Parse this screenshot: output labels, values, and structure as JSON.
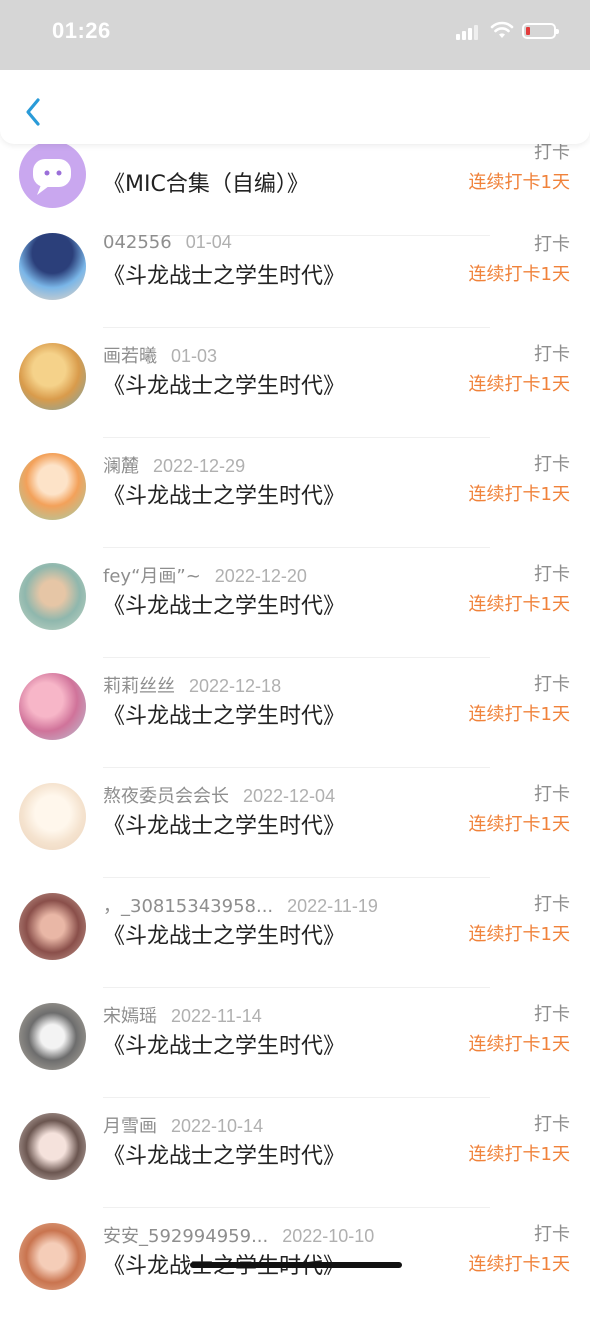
{
  "status_bar": {
    "time": "01:26"
  },
  "nav": {
    "back_icon": "chevron-left-icon"
  },
  "colors": {
    "accent": "#2a9bd8",
    "streak": "#f0823a",
    "muted": "#8e8e8e",
    "text": "#222222"
  },
  "rows": [
    {
      "user": "",
      "date": "",
      "book": "《MIC合集（自编）》",
      "action": "打卡",
      "streak": "连续打卡1天"
    },
    {
      "user": "042556",
      "date": "01-04",
      "book": "《斗龙战士之学生时代》",
      "action": "打卡",
      "streak": "连续打卡1天"
    },
    {
      "user": "画若曦",
      "date": "01-03",
      "book": "《斗龙战士之学生时代》",
      "action": "打卡",
      "streak": "连续打卡1天"
    },
    {
      "user": "澜麓",
      "date": "2022-12-29",
      "book": "《斗龙战士之学生时代》",
      "action": "打卡",
      "streak": "连续打卡1天"
    },
    {
      "user": "fey“月画”~",
      "date": "2022-12-20",
      "book": "《斗龙战士之学生时代》",
      "action": "打卡",
      "streak": "连续打卡1天"
    },
    {
      "user": "莉莉丝丝",
      "date": "2022-12-18",
      "book": "《斗龙战士之学生时代》",
      "action": "打卡",
      "streak": "连续打卡1天"
    },
    {
      "user": "熬夜委员会会长",
      "date": "2022-12-04",
      "book": "《斗龙战士之学生时代》",
      "action": "打卡",
      "streak": "连续打卡1天"
    },
    {
      "user": "，_30815343958...",
      "date": "2022-11-19",
      "book": "《斗龙战士之学生时代》",
      "action": "打卡",
      "streak": "连续打卡1天"
    },
    {
      "user": "宋嫣瑶",
      "date": "2022-11-14",
      "book": "《斗龙战士之学生时代》",
      "action": "打卡",
      "streak": "连续打卡1天"
    },
    {
      "user": "月雪画",
      "date": "2022-10-14",
      "book": "《斗龙战士之学生时代》",
      "action": "打卡",
      "streak": "连续打卡1天"
    },
    {
      "user": "安安_592994959...",
      "date": "2022-10-10",
      "book": "《斗龙战士之学生时代》",
      "action": "打卡",
      "streak": "连续打卡1天"
    }
  ]
}
